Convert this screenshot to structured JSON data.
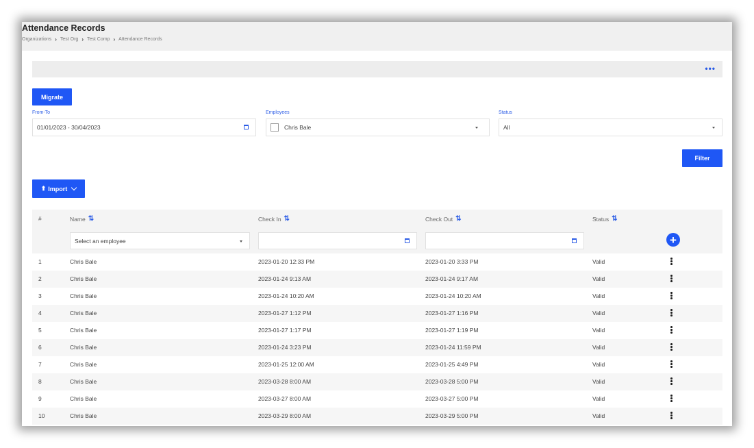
{
  "header": {
    "title": "Attendance Records",
    "breadcrumb": [
      "Organizations",
      "Test Org",
      "Test Comp",
      "Attendance Records"
    ]
  },
  "toolbar": {
    "more_label": "•••",
    "migrate_label": "Migrate",
    "filter_label": "Filter",
    "import_label": "Import"
  },
  "filters": {
    "from_to": {
      "label": "From-To",
      "value": "01/01/2023 - 30/04/2023"
    },
    "employees": {
      "label": "Employees",
      "value": "Chris Bale"
    },
    "status": {
      "label": "Status",
      "value": "All"
    }
  },
  "table": {
    "columns": [
      "#",
      "Name",
      "Check In",
      "Check Out",
      "Status"
    ],
    "name_filter_placeholder": "Select an employee",
    "rows": [
      {
        "num": "1",
        "name": "Chris Bale",
        "check_in": "2023-01-20 12:33 PM",
        "check_out": "2023-01-20 3:33 PM",
        "status": "Valid"
      },
      {
        "num": "2",
        "name": "Chris Bale",
        "check_in": "2023-01-24 9:13 AM",
        "check_out": "2023-01-24 9:17 AM",
        "status": "Valid"
      },
      {
        "num": "3",
        "name": "Chris Bale",
        "check_in": "2023-01-24 10:20 AM",
        "check_out": "2023-01-24 10:20 AM",
        "status": "Valid"
      },
      {
        "num": "4",
        "name": "Chris Bale",
        "check_in": "2023-01-27 1:12 PM",
        "check_out": "2023-01-27 1:16 PM",
        "status": "Valid"
      },
      {
        "num": "5",
        "name": "Chris Bale",
        "check_in": "2023-01-27 1:17 PM",
        "check_out": "2023-01-27 1:19 PM",
        "status": "Valid"
      },
      {
        "num": "6",
        "name": "Chris Bale",
        "check_in": "2023-01-24 3:23 PM",
        "check_out": "2023-01-24 11:59 PM",
        "status": "Valid"
      },
      {
        "num": "7",
        "name": "Chris Bale",
        "check_in": "2023-01-25 12:00 AM",
        "check_out": "2023-01-25 4:49 PM",
        "status": "Valid"
      },
      {
        "num": "8",
        "name": "Chris Bale",
        "check_in": "2023-03-28 8:00 AM",
        "check_out": "2023-03-28 5:00 PM",
        "status": "Valid"
      },
      {
        "num": "9",
        "name": "Chris Bale",
        "check_in": "2023-03-27 8:00 AM",
        "check_out": "2023-03-27 5:00 PM",
        "status": "Valid"
      },
      {
        "num": "10",
        "name": "Chris Bale",
        "check_in": "2023-03-29 8:00 AM",
        "check_out": "2023-03-29 5:00 PM",
        "status": "Valid"
      }
    ]
  },
  "colors": {
    "accent": "#1f57f5",
    "label_blue": "#2b5ce6",
    "header_bg": "#f0f0f0",
    "row_alt": "#f6f6f6"
  }
}
